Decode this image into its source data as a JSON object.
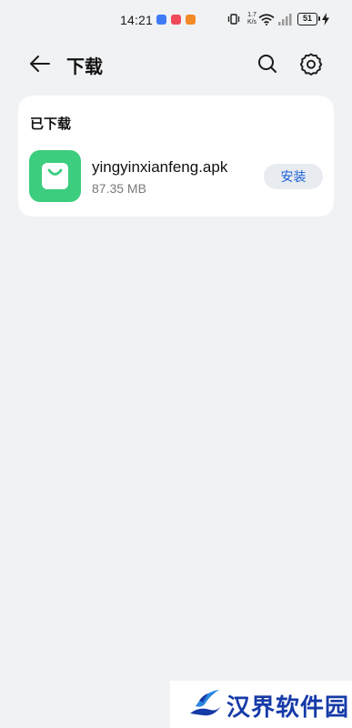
{
  "status_bar": {
    "time": "14:21",
    "net_speed_value": "1.7",
    "net_speed_unit": "K/s",
    "battery": "51"
  },
  "header": {
    "title": "下载"
  },
  "downloaded": {
    "section_title": "已下载",
    "items": [
      {
        "file_name": "yingyinxianfeng.apk",
        "size": "87.35 MB",
        "action_label": "安装",
        "icon": "shopping-bag-icon"
      }
    ]
  },
  "watermark": {
    "text": "汉界软件园"
  },
  "colors": {
    "background": "#f1f2f4",
    "card": "#ffffff",
    "app_icon_bg": "#3ccd7f",
    "accent": "#1c5fd8",
    "install_button_bg": "#e8ebef"
  }
}
